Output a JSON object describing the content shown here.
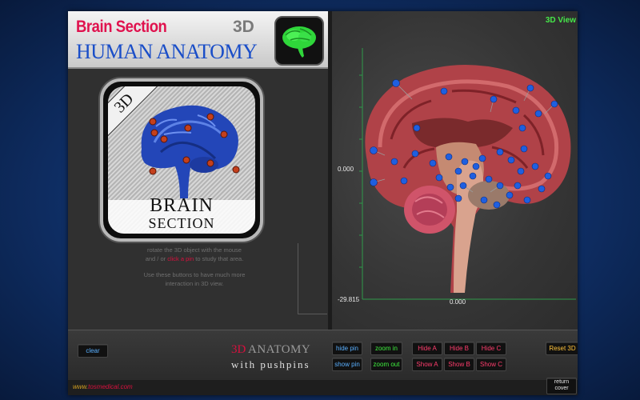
{
  "header": {
    "title": "Brain Section",
    "badge": "3D",
    "subtitle": "HUMAN ANATOMY"
  },
  "left_panel": {
    "icon": {
      "badge": "3D",
      "label_line1": "BRAIN",
      "label_line2": "SECTION"
    },
    "help": {
      "line1": "rotate the 3D object with the mouse",
      "line2_pre": "and / or",
      "line2_link": "click a pin",
      "line2_post": "to study that area.",
      "line3": "Use these buttons to have much more",
      "line4": "interaction in 3D view."
    }
  },
  "view": {
    "label": "3D View",
    "y_label": "0.000",
    "y_min": "-29.815",
    "x_label": "0.000"
  },
  "toolbar": {
    "clear": "clear",
    "hide_pin": "hide pin",
    "show_pin": "show pin",
    "zoom_in": "zoom in",
    "zoom_out": "zoom out",
    "hide_a": "Hide A",
    "hide_b": "Hide B",
    "hide_c": "Hide C",
    "show_a": "Show A",
    "show_b": "Show B",
    "show_c": "Show C",
    "reset_3d": "Reset 3D",
    "return_cover": "return cover"
  },
  "logo": {
    "prefix": "3D",
    "name": "ANATOMY",
    "tagline": "with pushpins"
  },
  "footer": {
    "website": "www.",
    "website_tail": "tosmedical.com"
  },
  "colors": {
    "accent_red": "#d8103e",
    "accent_blue": "#1a4ec8",
    "view_label": "#46e84a"
  }
}
